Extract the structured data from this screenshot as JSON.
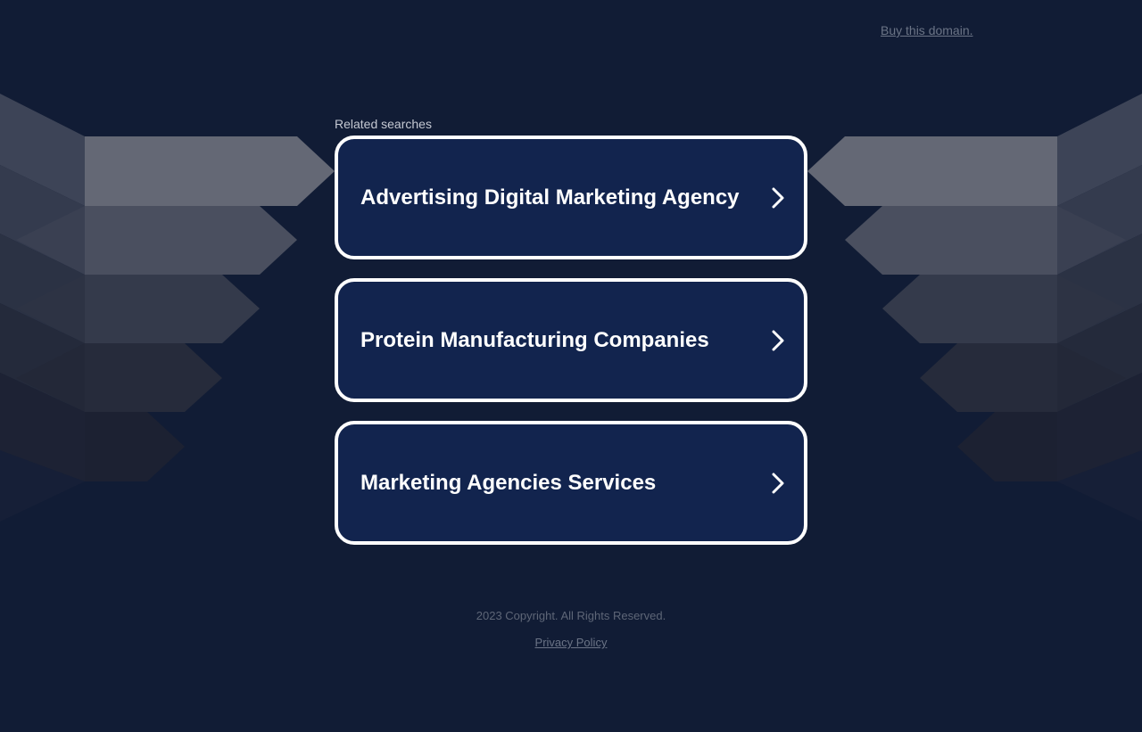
{
  "header": {
    "buy_link": "Buy this domain."
  },
  "related": {
    "title": "Related searches",
    "items": [
      {
        "label": "Advertising Digital Marketing Agency",
        "icon": "chevron-right-icon"
      },
      {
        "label": "Protein Manufacturing Companies",
        "icon": "chevron-right-icon"
      },
      {
        "label": "Marketing Agencies Services",
        "icon": "chevron-right-icon"
      }
    ]
  },
  "footer": {
    "copyright": "2023 Copyright. All Rights Reserved.",
    "privacy_link": "Privacy Policy"
  },
  "colors": {
    "background": "#111c35",
    "card_background": "#12244e",
    "card_border": "#ffffff"
  }
}
